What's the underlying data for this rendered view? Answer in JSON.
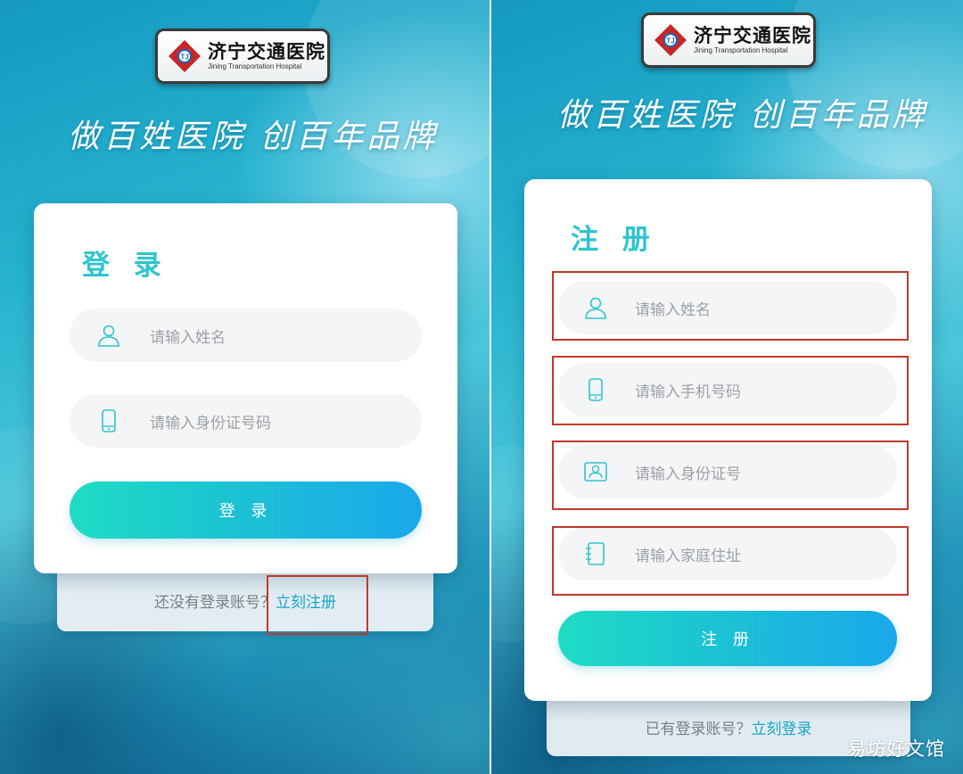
{
  "hospital": {
    "name_cn": "济宁交通医院",
    "name_en": "Jining Transportation Hospital"
  },
  "slogan": "做百姓医院 创百年品牌",
  "login": {
    "title": "登 录",
    "name_placeholder": "请输入姓名",
    "id_placeholder": "请输入身份证号码",
    "button": "登 录",
    "footer_prompt": "还没有登录账号？",
    "footer_link": "立刻注册"
  },
  "register": {
    "title": "注 册",
    "name_placeholder": "请输入姓名",
    "phone_placeholder": "请输入手机号码",
    "id_placeholder": "请输入身份证号",
    "address_placeholder": "请输入家庭住址",
    "button": "注 册",
    "footer_prompt": "已有登录账号？",
    "footer_link": "立刻登录"
  },
  "watermark": "易坊好文馆",
  "colors": {
    "accent": "#2ec4cf",
    "link": "#1aa3c7",
    "highlight": "#c0392b",
    "button_start": "#1fdcc4",
    "button_end": "#1aa8ec"
  },
  "icons": {
    "user": "user-icon",
    "phone": "phone-icon",
    "id_card": "id-card-icon",
    "address": "address-book-icon",
    "logo": "hospital-logo-icon"
  }
}
